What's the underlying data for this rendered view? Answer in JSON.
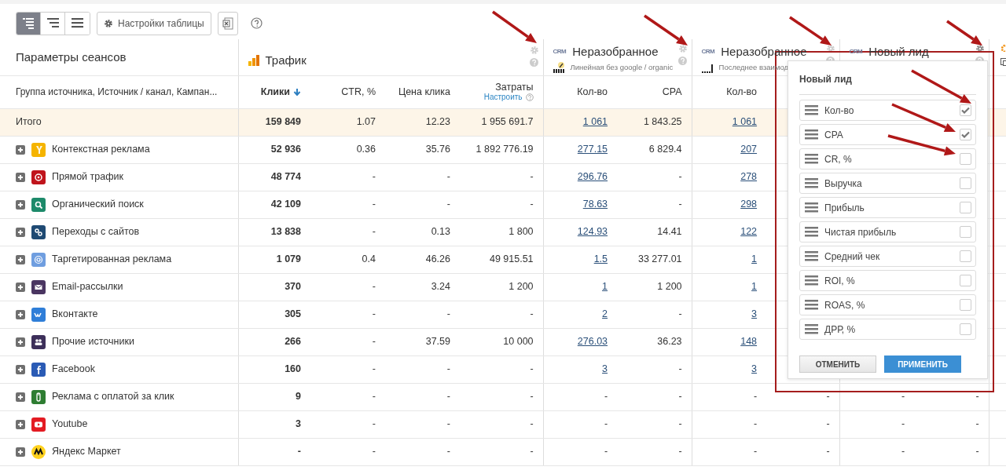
{
  "toolbar": {
    "view_buttons": [
      {
        "kind": "tree",
        "selected": true
      },
      {
        "kind": "indent",
        "selected": false
      },
      {
        "kind": "flat",
        "selected": false
      }
    ],
    "settings_button": "Настройки таблицы"
  },
  "table": {
    "groups": [
      {
        "kind": "params",
        "title": "Параметры сеансов",
        "columns": [
          {
            "label": "Группа источника, Источник / канал, Кампан..."
          }
        ]
      },
      {
        "kind": "traffic",
        "title": "Трафик",
        "columns": [
          {
            "label": "Клики",
            "sorted": true,
            "bold": true
          },
          {
            "label": "CTR, %",
            "sorted": false,
            "bold": false
          },
          {
            "label": "Цена клика",
            "sorted": false,
            "bold": false
          },
          {
            "label": "Затраты",
            "sorted": false,
            "bold": false,
            "link": "Настроить"
          }
        ]
      },
      {
        "kind": "crm",
        "tag": "CRM",
        "title": "Неразобранное",
        "subtitle": "Линейная без google / organic",
        "columns": [
          {
            "label": "Кол-во"
          },
          {
            "label": "CPA"
          }
        ]
      },
      {
        "kind": "crm",
        "tag": "CRM",
        "title": "Неразобранное",
        "subtitle": "Последнее взаимод",
        "columns": [
          {
            "label": "Кол-во"
          }
        ]
      },
      {
        "kind": "crm",
        "tag": "CRM",
        "title": "Новый лид"
      },
      {
        "kind": "partial"
      }
    ],
    "rows": [
      {
        "kind": "total",
        "label": "Итого",
        "cells": [
          "159 849",
          "1.07",
          "12.23",
          "1 955 691.7",
          {
            "text": "1 061",
            "link": true
          },
          "1 843.25",
          {
            "text": "1 061",
            "link": true
          }
        ]
      },
      {
        "kind": "yandex",
        "color": "#f5b400",
        "label": "Контекстная реклама",
        "cells": [
          "52 936",
          "0.36",
          "35.76",
          "1 892 776.19",
          {
            "text": "277.15",
            "link": true
          },
          "6 829.4",
          {
            "text": "207",
            "link": true
          }
        ]
      },
      {
        "kind": "direct",
        "color": "#c0141c",
        "label": "Прямой трафик",
        "cells": [
          "48 774",
          "-",
          "-",
          "-",
          {
            "text": "296.76",
            "link": true
          },
          "-",
          {
            "text": "278",
            "link": true
          }
        ]
      },
      {
        "kind": "search",
        "color": "#1d8a6a",
        "label": "Органический поиск",
        "cells": [
          "42 109",
          "-",
          "-",
          "-",
          {
            "text": "78.63",
            "link": true
          },
          "-",
          {
            "text": "298",
            "link": true
          }
        ]
      },
      {
        "kind": "link",
        "color": "#1f4a73",
        "label": "Переходы с сайтов",
        "cells": [
          "13 838",
          "-",
          "0.13",
          "1 800",
          {
            "text": "124.93",
            "link": true
          },
          "14.41",
          {
            "text": "122",
            "link": true
          }
        ]
      },
      {
        "kind": "target",
        "color": "#6f9ee0",
        "label": "Таргетированная реклама",
        "cells": [
          "1 079",
          "0.4",
          "46.26",
          "49 915.51",
          {
            "text": "1.5",
            "link": true
          },
          "33 277.01",
          {
            "text": "1",
            "link": true
          }
        ]
      },
      {
        "kind": "mail",
        "color": "#4a3561",
        "label": "Email-рассылки",
        "cells": [
          "370",
          "-",
          "3.24",
          "1 200",
          {
            "text": "1",
            "link": true
          },
          "1 200",
          {
            "text": "1",
            "link": true
          }
        ]
      },
      {
        "kind": "vk",
        "color": "#2f7ed8",
        "label": "Вконтакте",
        "cells": [
          "305",
          "-",
          "-",
          "-",
          {
            "text": "2",
            "link": true
          },
          "-",
          {
            "text": "3",
            "link": true
          }
        ]
      },
      {
        "kind": "people",
        "color": "#3d2f5a",
        "label": "Прочие источники",
        "cells": [
          "266",
          "-",
          "37.59",
          "10 000",
          {
            "text": "276.03",
            "link": true
          },
          "36.23",
          {
            "text": "148",
            "link": true
          }
        ]
      },
      {
        "kind": "facebook",
        "color": "#2a5bb5",
        "label": "Facebook",
        "cells": [
          "160",
          "-",
          "-",
          "-",
          {
            "text": "3",
            "link": true
          },
          "-",
          {
            "text": "3",
            "link": true
          }
        ]
      },
      {
        "kind": "ppc",
        "color": "#2e7d32",
        "label": "Реклама с оплатой за клик",
        "cells": [
          "9",
          "-",
          "-",
          "-",
          "-",
          "-",
          "-",
          "-",
          "-",
          "-"
        ]
      },
      {
        "kind": "youtube",
        "color": "#e31b23",
        "label": "Youtube",
        "cells": [
          "3",
          "-",
          "-",
          "-",
          "-",
          "-",
          "-",
          "-",
          "-",
          "-"
        ]
      },
      {
        "kind": "market",
        "color": "#ffd21f",
        "label": "Яндекс Маркет",
        "cells": [
          "-",
          "-",
          "-",
          "-",
          "-",
          "-",
          "-",
          "-",
          "-",
          "-"
        ]
      }
    ]
  },
  "popup": {
    "title": "Новый лид",
    "items": [
      {
        "label": "Кол-во",
        "checked": true
      },
      {
        "label": "CPA",
        "checked": true
      },
      {
        "label": "CR, %",
        "checked": false
      },
      {
        "label": "Выручка",
        "checked": false
      },
      {
        "label": "Прибыль",
        "checked": false
      },
      {
        "label": "Чистая прибыль",
        "checked": false
      },
      {
        "label": "Средний чек",
        "checked": false
      },
      {
        "label": "ROI, %",
        "checked": false
      },
      {
        "label": "ROAS, %",
        "checked": false
      },
      {
        "label": "ДРР, %",
        "checked": false
      }
    ],
    "cancel_button": "ОТМЕНИТЬ",
    "apply_button": "ПРИМЕНИТЬ"
  }
}
